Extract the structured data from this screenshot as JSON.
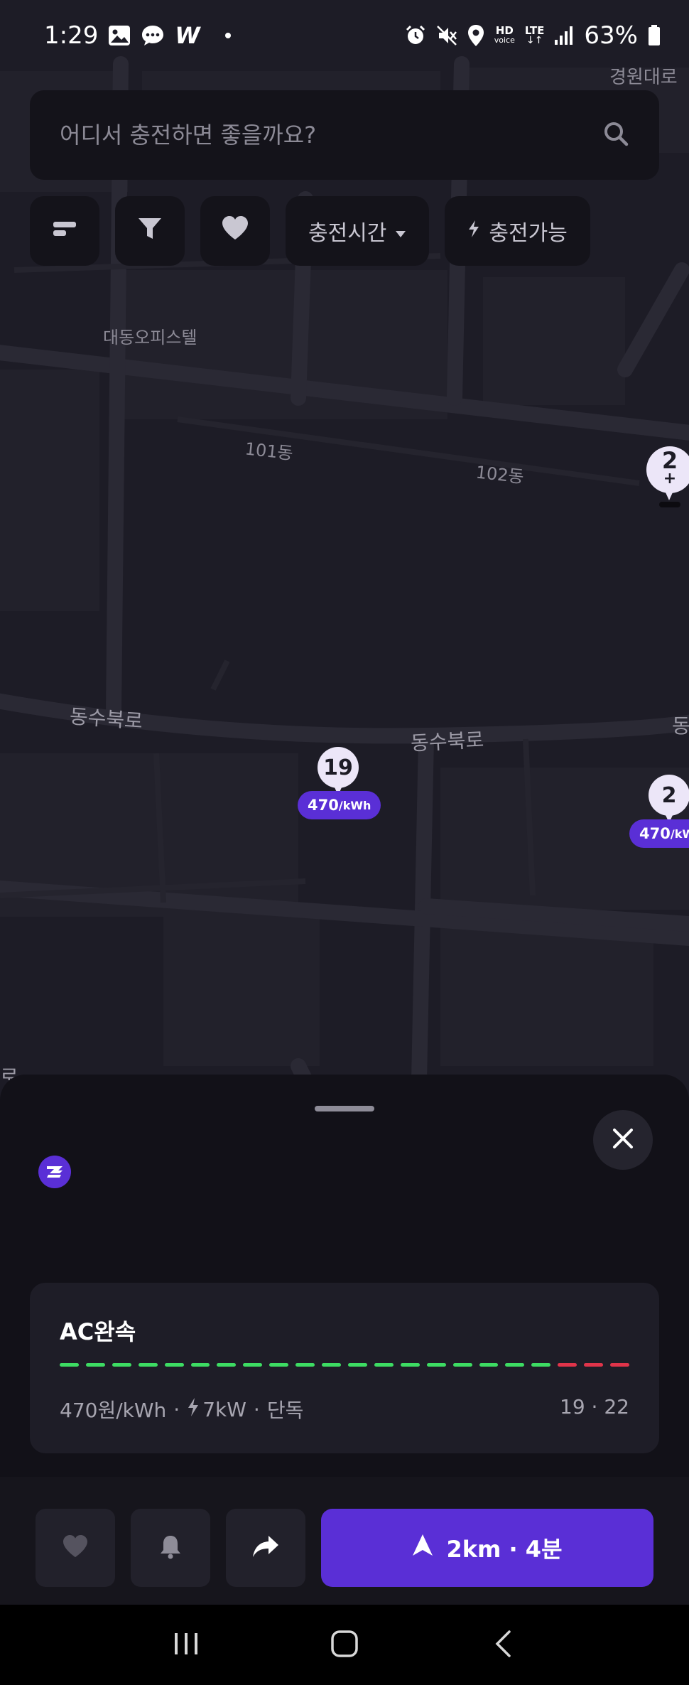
{
  "status_bar": {
    "time": "1:29",
    "battery": "63%",
    "hd_label": "HD",
    "voice_label": "voice",
    "lte_label": "LTE"
  },
  "search": {
    "placeholder": "어디서 충전하면 좋을까요?"
  },
  "filters": {
    "charge_time_label": "충전시간",
    "available_label": "충전가능"
  },
  "map": {
    "labels": {
      "gyeongwon": "경원대로",
      "daedong": "대동오피스텔",
      "bldg101": "101동",
      "bldg102": "102동",
      "road_west": "동수북로",
      "road_mid": "동수북로",
      "road_east": "동",
      "road_left_edge": "로"
    },
    "pins": {
      "top_right_count": "2",
      "top_right_plus": "+",
      "center_count": "19",
      "center_price": "470",
      "center_unit": "/kWh",
      "right_count": "2",
      "right_price": "470",
      "right_unit": "/kW"
    }
  },
  "sheet": {
    "charger": {
      "title": "AC완속",
      "price": "470원/kWh",
      "power": "7kW",
      "type": "단독",
      "count": "19 · 22",
      "separator": "·",
      "slots_available": 19,
      "slots_total": 22
    },
    "navigate_label": "2km · 4분"
  },
  "colors": {
    "accent": "#5a2fd6",
    "available_slot": "#3ddc63",
    "busy_slot": "#e0344a"
  }
}
